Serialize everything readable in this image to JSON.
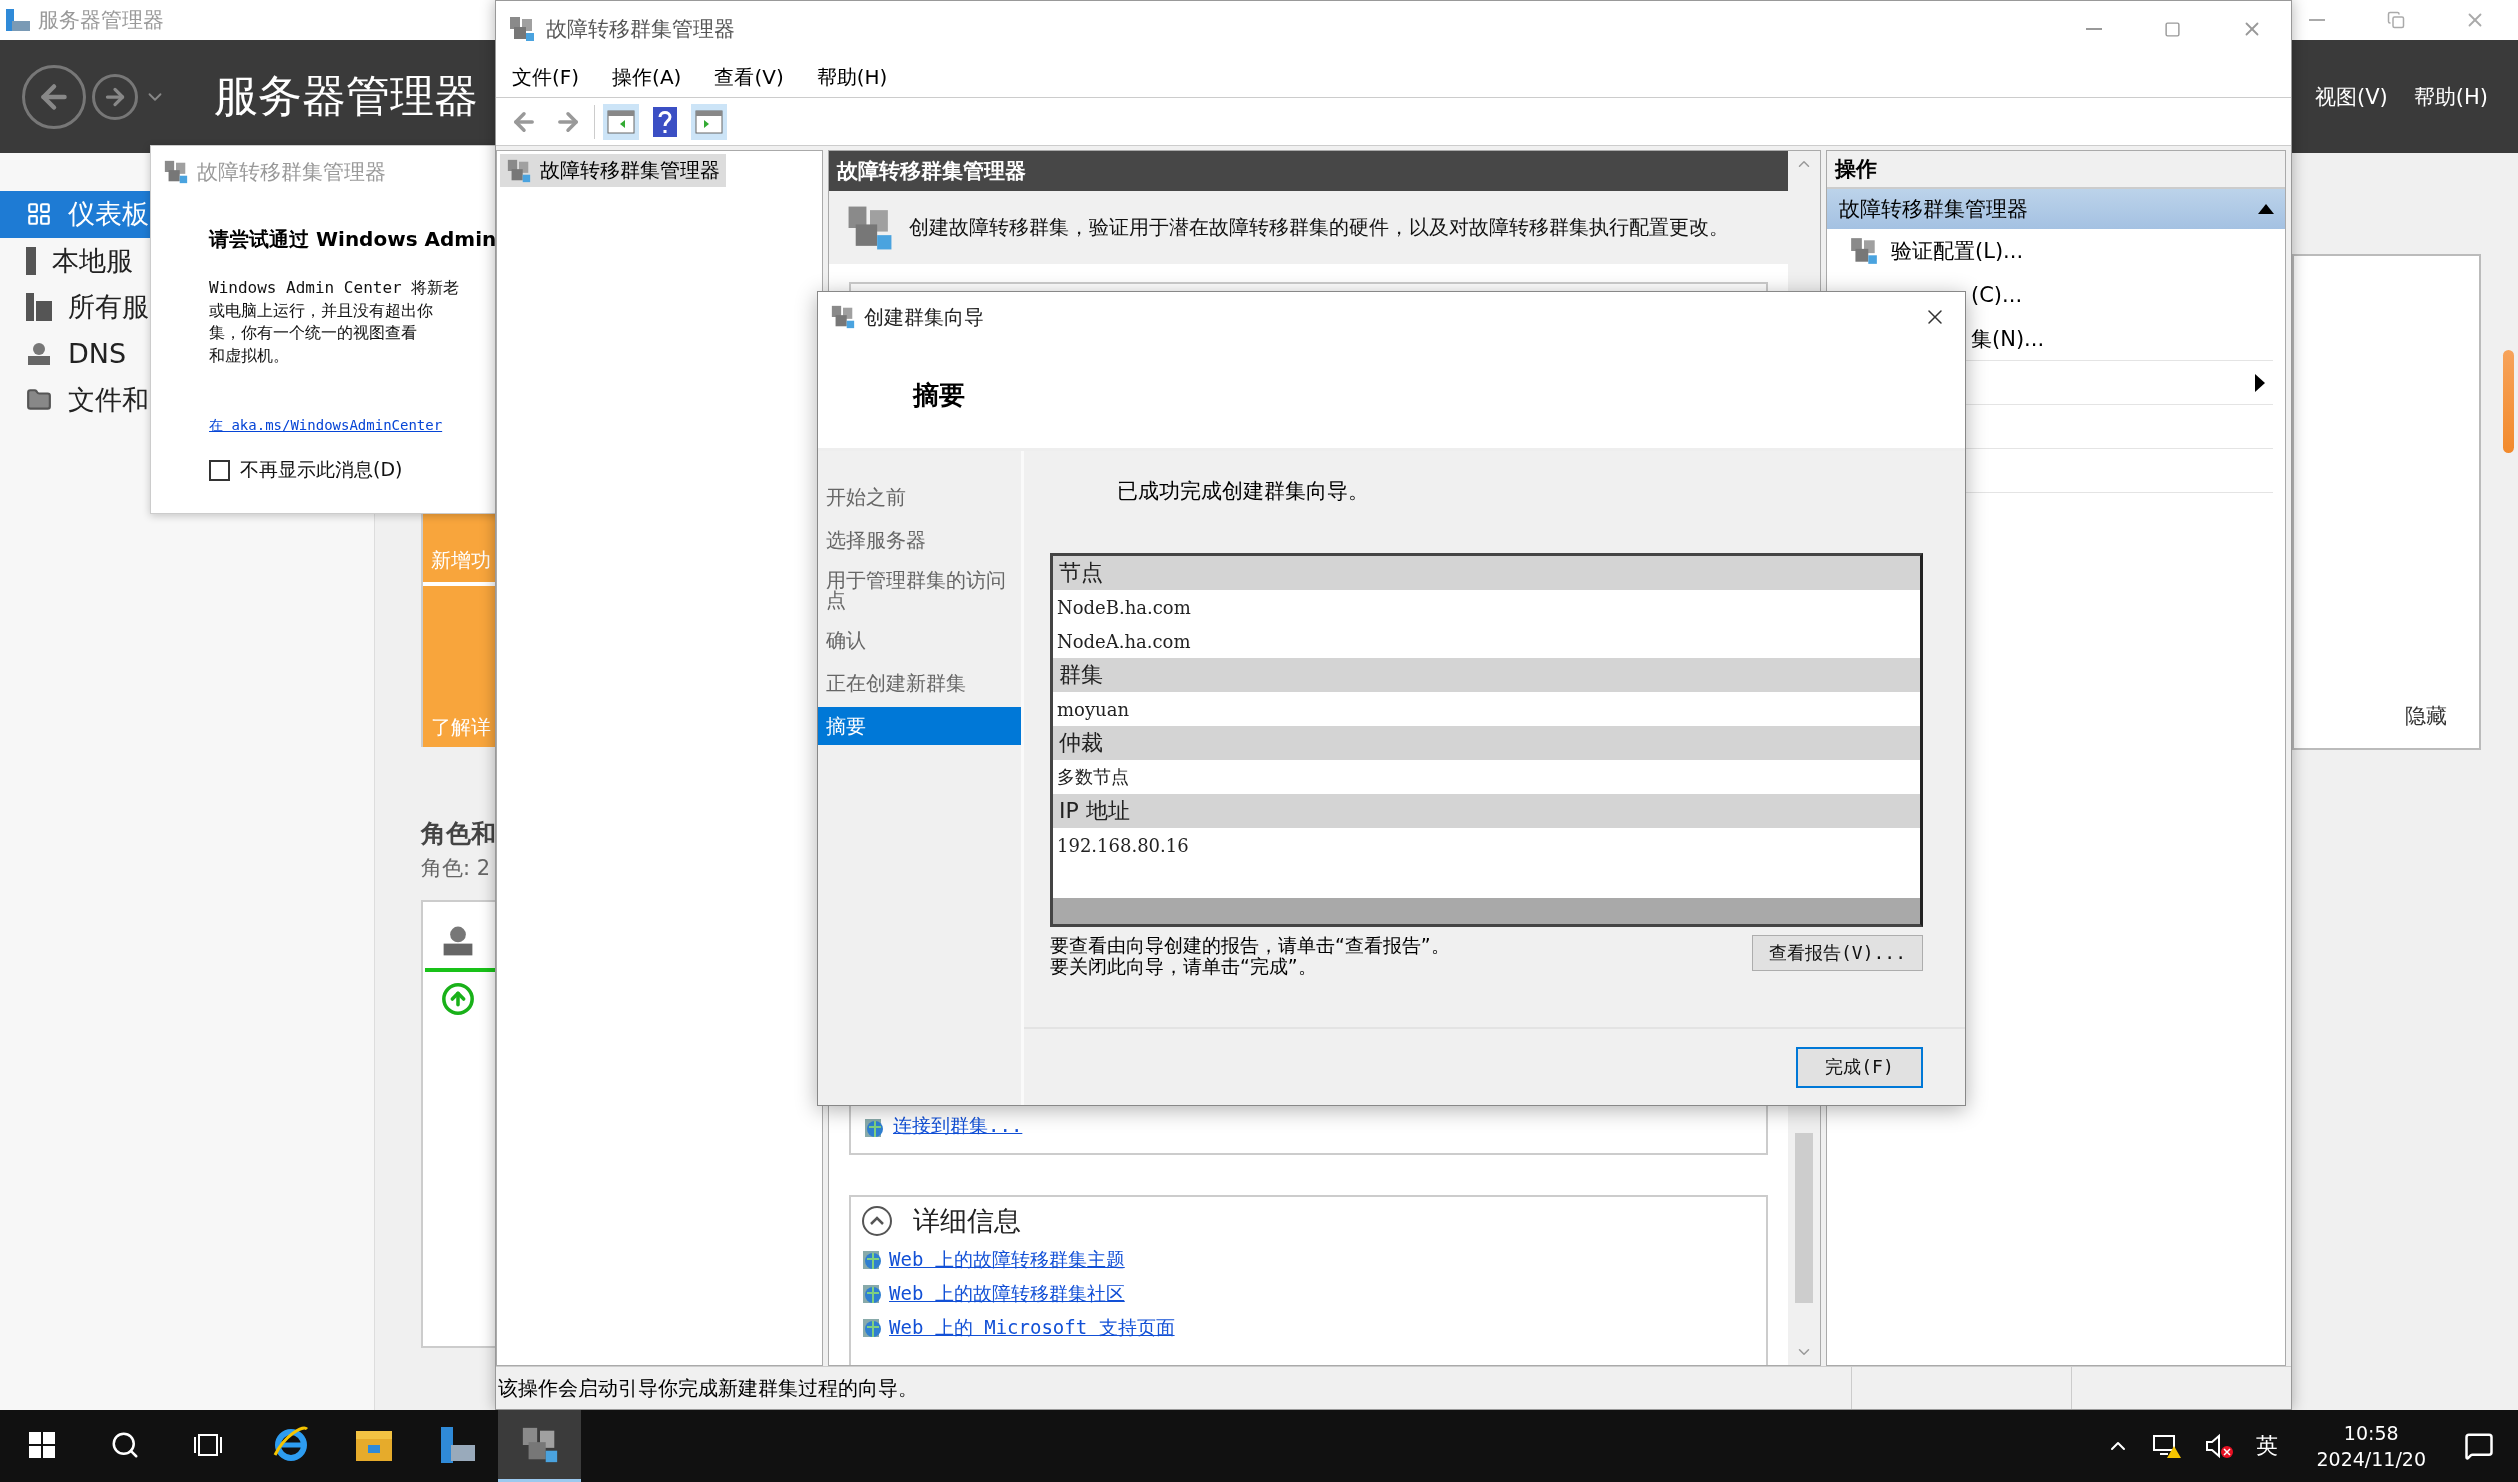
{
  "server_manager": {
    "title": "服务器管理器",
    "header_title": "服务器管理器",
    "menu": [
      "视图(V)",
      "帮助(H)"
    ],
    "nav": [
      {
        "label": "仪表板",
        "kind": "dashboard",
        "selected": true
      },
      {
        "label": "本地服",
        "kind": "local",
        "selected": false
      },
      {
        "label": "所有服",
        "kind": "all",
        "selected": false
      },
      {
        "label": "DNS",
        "kind": "dns",
        "selected": false
      },
      {
        "label": "文件和",
        "kind": "files",
        "selected": false
      }
    ],
    "notice": {
      "title": "故障转移群集管理器",
      "heading": "请尝试通过 Windows Admin",
      "body": [
        "Windows Admin Center 将新老",
        "或电脑上运行，并且没有超出你",
        "集，你有一个统一的视图查看",
        "和虚拟机。"
      ],
      "link": "在 aka.ms/WindowsAdminCenter",
      "checkbox": {
        "label": "不再显示此消息(D)",
        "checked": false
      }
    },
    "tile": {
      "top": "新增功",
      "bottom": "了解详"
    },
    "roles": {
      "title": "角色和",
      "count": "角色: 2"
    },
    "hide_panel": {
      "label": "隐藏"
    }
  },
  "cluster_manager": {
    "title": "故障转移群集管理器",
    "menu": [
      "文件(F)",
      "操作(A)",
      "查看(V)",
      "帮助(H)"
    ],
    "tree": [
      {
        "label": "故障转移群集管理器",
        "selected": true
      }
    ],
    "center": {
      "header": "故障转移群集管理器",
      "description": "创建故障转移群集，验证用于潜在故障转移群集的硬件，以及对故障转移群集执行配置更改。",
      "connect_link": "连接到群集...",
      "details": {
        "title": "详细信息",
        "expanded": true,
        "links": [
          "Web 上的故障转移群集主题",
          "Web 上的故障转移群集社区",
          "Web 上的 Microsoft 支持页面"
        ]
      }
    },
    "actions": {
      "title": "操作",
      "section": {
        "label": "故障转移群集管理器",
        "expanded": true
      },
      "items": [
        {
          "kind": "item",
          "label": "验证配置(L)..."
        },
        {
          "kind": "covered",
          "label": "(C)..."
        },
        {
          "kind": "covered",
          "label": "集(N)..."
        },
        {
          "kind": "submenu"
        }
      ]
    },
    "status": "该操作会启动引导你完成新建群集过程的向导。"
  },
  "wizard": {
    "title": "创建群集向导",
    "heading": "摘要",
    "steps": [
      {
        "label": "开始之前",
        "selected": false
      },
      {
        "label": "选择服务器",
        "selected": false
      },
      {
        "label": "用于管理群集的访问点",
        "selected": false
      },
      {
        "label": "确认",
        "selected": false
      },
      {
        "label": "正在创建新群集",
        "selected": false
      },
      {
        "label": "摘要",
        "selected": true
      }
    ],
    "message": "已成功完成创建群集向导。",
    "report": [
      {
        "kind": "heading",
        "text": "节点"
      },
      {
        "kind": "value",
        "text": "NodeB.ha.com"
      },
      {
        "kind": "value",
        "text": "NodeA.ha.com"
      },
      {
        "kind": "heading",
        "text": "群集"
      },
      {
        "kind": "value",
        "text": "moyuan"
      },
      {
        "kind": "heading",
        "text": "仲裁"
      },
      {
        "kind": "value",
        "text": "多数节点"
      },
      {
        "kind": "heading",
        "text": "IP 地址"
      },
      {
        "kind": "value",
        "text": "192.168.80.16"
      }
    ],
    "note": [
      "要查看由向导创建的报告，请单击“查看报告”。",
      "要关闭此向导，请单击“完成”。"
    ],
    "view_report": "查看报告(V)...",
    "finish": "完成(F)"
  },
  "taskbar": {
    "apps": [
      {
        "kind": "ie",
        "selected": false
      },
      {
        "kind": "explorer",
        "selected": false
      },
      {
        "kind": "server",
        "selected": false
      },
      {
        "kind": "cluster",
        "selected": true
      }
    ],
    "ime": "英",
    "time": "10:58",
    "date": "2024/11/20"
  }
}
